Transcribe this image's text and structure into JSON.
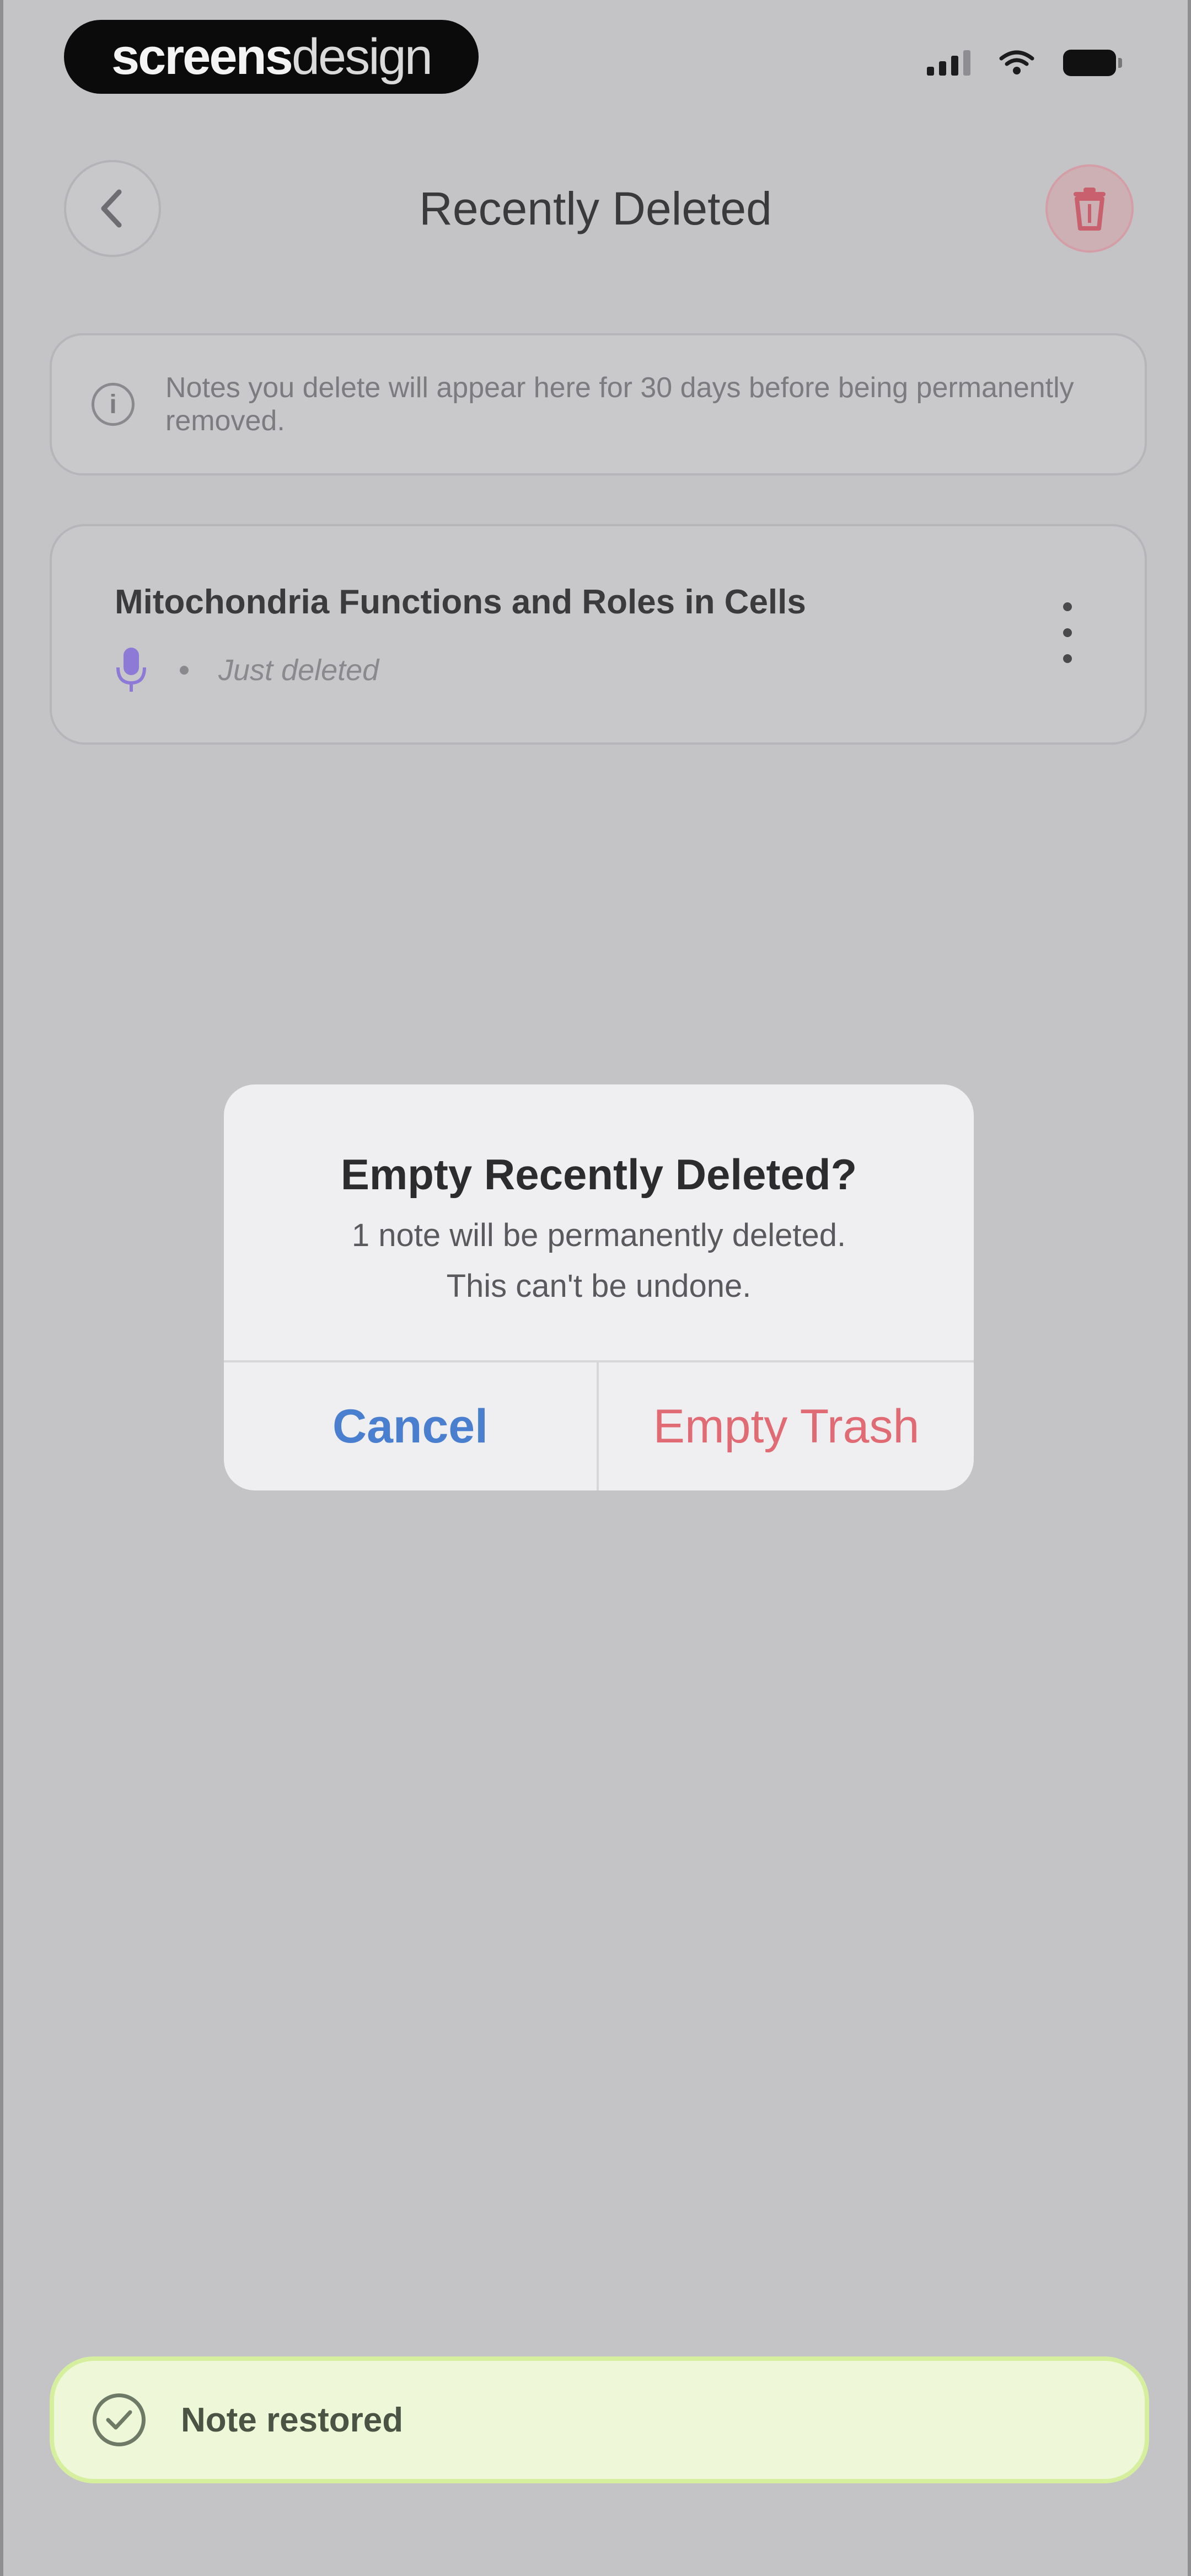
{
  "status_bar": {
    "brand_bold": "screens",
    "brand_light": "design",
    "icons": [
      "cellular-signal-icon",
      "wifi-icon",
      "battery-icon"
    ]
  },
  "header": {
    "title": "Recently Deleted",
    "back_icon": "chevron-left-icon",
    "trash_icon": "trash-icon"
  },
  "info_banner": {
    "icon": "info-icon",
    "text": "Notes you delete will appear here for 30 days before being permanently removed."
  },
  "notes": [
    {
      "title": "Mitochondria Functions and Roles in Cells",
      "type_icon": "microphone-icon",
      "time": "Just deleted"
    }
  ],
  "alert": {
    "title": "Empty Recently Deleted?",
    "message_line1": "1 note will be permanently deleted.",
    "message_line2": "This can't be undone.",
    "cancel_label": "Cancel",
    "confirm_label": "Empty Trash"
  },
  "toast": {
    "icon": "check-circle-icon",
    "text": "Note restored"
  },
  "colors": {
    "accent_blue": "#4a7fd0",
    "destructive_red": "#e06b74",
    "toast_background": "#eef8d8",
    "mic_purple": "#8d79d6"
  }
}
